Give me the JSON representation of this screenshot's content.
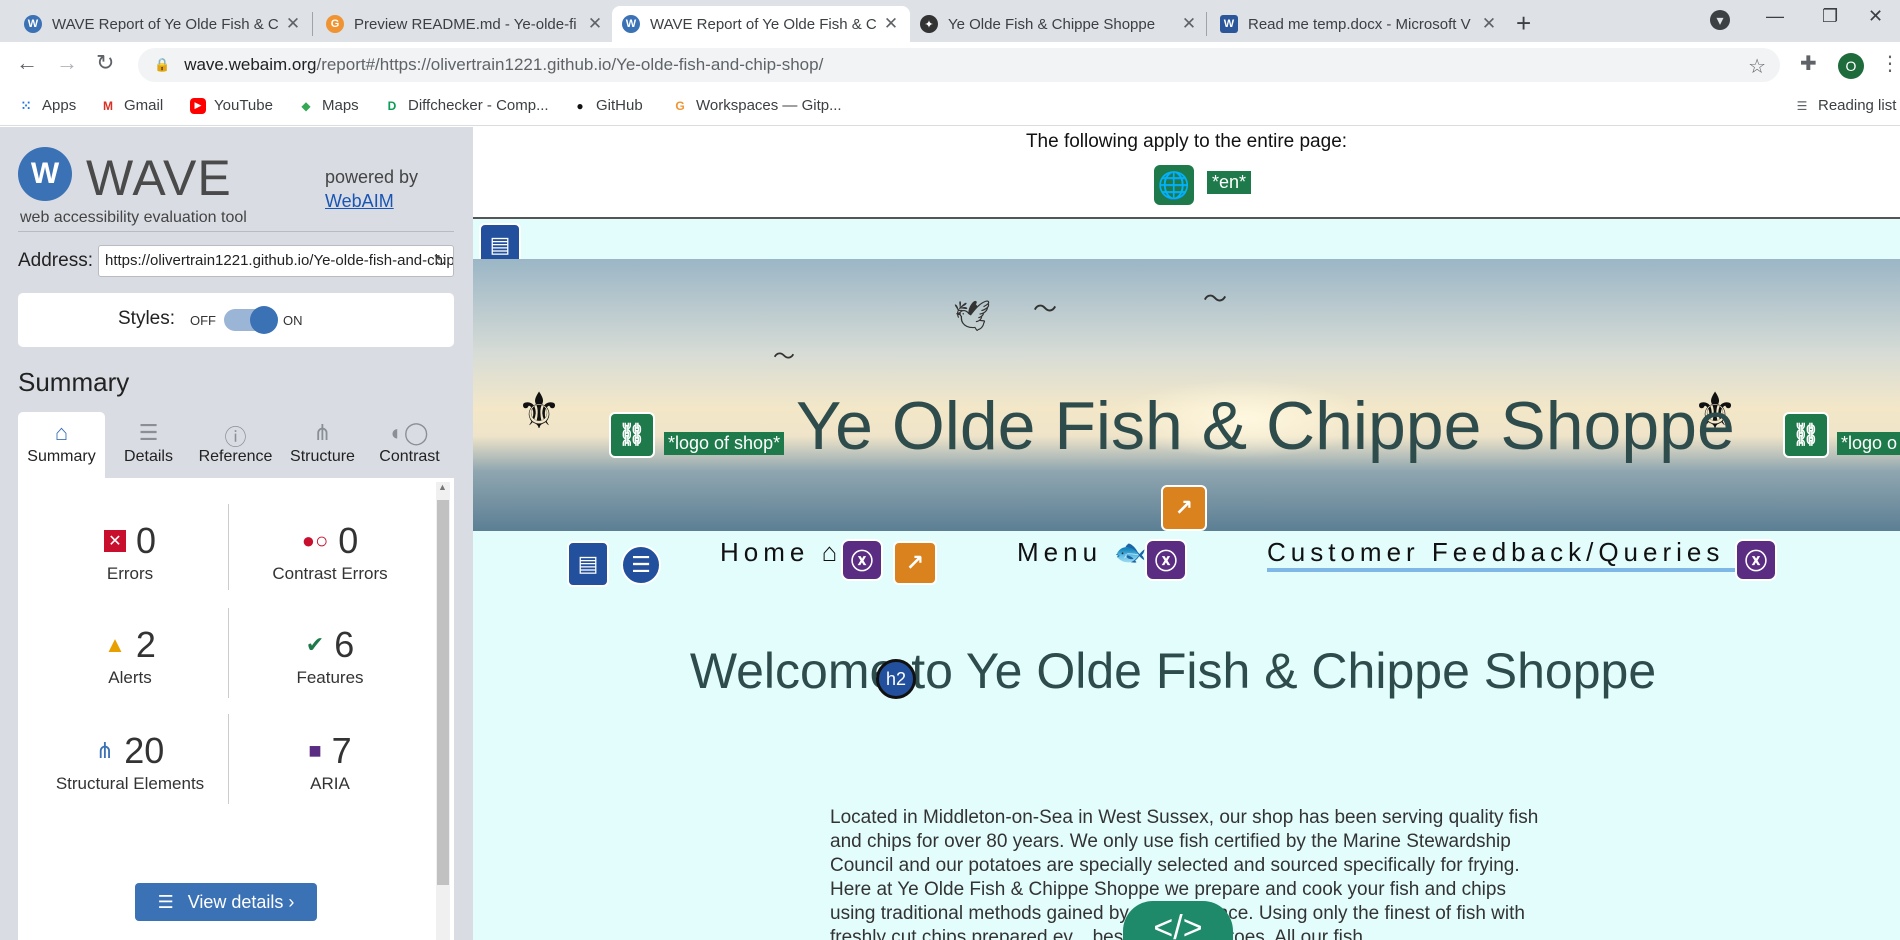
{
  "browser": {
    "tabs": [
      {
        "title": "WAVE Report of Ye Olde Fish & C",
        "active": false
      },
      {
        "title": "Preview README.md - Ye-olde-fi",
        "active": false
      },
      {
        "title": "WAVE Report of Ye Olde Fish & C",
        "active": true
      },
      {
        "title": "Ye Olde Fish & Chippe Shoppe",
        "active": false
      },
      {
        "title": "Read me temp.docx - Microsoft V",
        "active": false
      }
    ],
    "url_domain": "wave.webaim.org",
    "url_rest": "/report#/https://olivertrain1221.github.io/Ye-olde-fish-and-chip-shop/",
    "profile_initial": "O",
    "bookmarks": [
      {
        "label": "Apps",
        "icon": "apps-icon"
      },
      {
        "label": "Gmail",
        "icon": "gmail-icon"
      },
      {
        "label": "YouTube",
        "icon": "youtube-icon"
      },
      {
        "label": "Maps",
        "icon": "maps-icon"
      },
      {
        "label": "Diffchecker - Comp...",
        "icon": "diffchecker-icon"
      },
      {
        "label": "GitHub",
        "icon": "github-icon"
      },
      {
        "label": "Workspaces — Gitp...",
        "icon": "gitpod-icon"
      }
    ],
    "reading_list": "Reading list"
  },
  "wave": {
    "logo_text": "WAVE",
    "subtitle": "web accessibility evaluation tool",
    "powered_by": "powered by",
    "webaim_link": "WebAIM",
    "address_label": "Address:",
    "address_value": "https://olivertrain1221.github.io/Ye-olde-fish-and-chip-shop/",
    "styles_label": "Styles:",
    "styles_off": "OFF",
    "styles_on": "ON",
    "styles_state": "on",
    "summary_title": "Summary",
    "tabs": [
      "Summary",
      "Details",
      "Reference",
      "Structure",
      "Contrast"
    ],
    "active_tab": "Summary",
    "stats": [
      {
        "label": "Errors",
        "value": "0",
        "color": "#c8102e"
      },
      {
        "label": "Contrast Errors",
        "value": "0",
        "color": "#c8102e"
      },
      {
        "label": "Alerts",
        "value": "2",
        "color": "#e8a000"
      },
      {
        "label": "Features",
        "value": "6",
        "color": "#1e7a4a"
      },
      {
        "label": "Structural Elements",
        "value": "20",
        "color": "#3b71b5"
      },
      {
        "label": "ARIA",
        "value": "7",
        "color": "#5a2d82"
      }
    ],
    "view_details": "View details ›"
  },
  "report": {
    "applies_text": "The following apply to the entire page:",
    "lang_tag": "*en*",
    "site_title": "Ye Olde Fish & Chippe Shoppe",
    "logo_alt": "*logo of shop*",
    "logo_alt_cut": "*logo o",
    "nav": [
      "Home",
      "Menu",
      "Customer Feedback/Queries"
    ],
    "h2_badge": "h2",
    "welcome_heading": "Welcome to Ye Olde Fish & Chippe Shoppe",
    "body_text": "Located in Middleton-on-Sea in West Sussex, our shop has been serving quality fish and chips for over 80 years. We only use fish certified by the Marine Stewardship Council and our potatoes are specially selected and sourced specifically for frying. Here at Ye Olde Fish & Chippe Shoppe we prepare and cook your fish and chips using traditional methods gained by ... experience. Using only the finest of fish with freshly cut chips prepared ev... best British potatoes. All our fish",
    "code_toggle": "</>"
  }
}
